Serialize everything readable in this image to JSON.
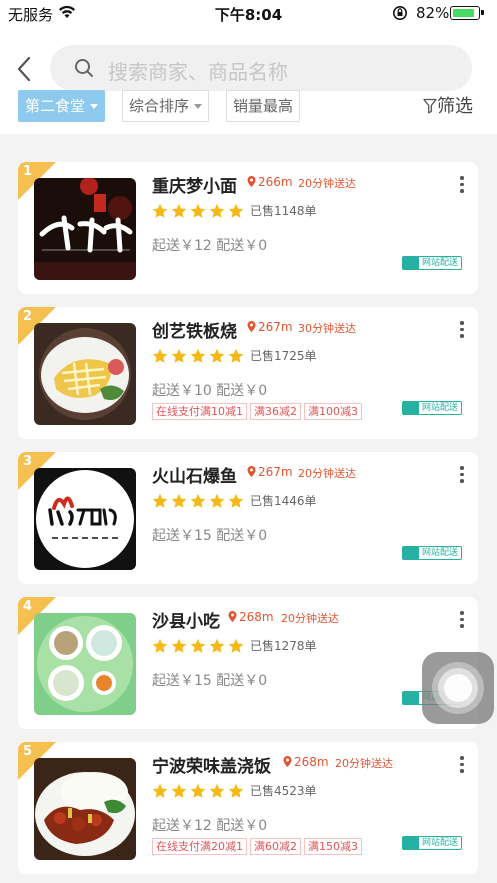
{
  "status_bar": {
    "carrier": "无服务",
    "time": "下午8:04",
    "battery": "82%"
  },
  "search": {
    "placeholder": "搜索商家、商品名称"
  },
  "filters": {
    "canteen": "第二食堂",
    "sort": "综合排序",
    "sales": "销量最高",
    "filter": "筛选"
  },
  "delivery_tag": "网站配送",
  "colors": {
    "accent": "#8ec9ee",
    "rank": "#f5c04f",
    "star": "#f5b917",
    "distance": "#e2552f",
    "delivery": "#27b1a3"
  },
  "stores": [
    {
      "rank": "1",
      "name": "重庆梦小面",
      "distance": "266m",
      "eta": "20分钟送达",
      "rating": 5,
      "sold": "已售1148单",
      "min_order": "起送￥12",
      "delivery_fee": "配送￥0",
      "promos": [],
      "thumb_icon": "noodle-poster-image"
    },
    {
      "rank": "2",
      "name": "创艺铁板烧",
      "distance": "267m",
      "eta": "30分钟送达",
      "rating": 5,
      "sold": "已售1725单",
      "min_order": "起送￥10",
      "delivery_fee": "配送￥0",
      "promos": [
        "在线支付满10减1",
        "满36减2",
        "满100减3"
      ],
      "thumb_icon": "teppanyaki-plate-image"
    },
    {
      "rank": "3",
      "name": "火山石爆鱼",
      "distance": "267m",
      "eta": "20分钟送达",
      "rating": 5,
      "sold": "已售1446单",
      "min_order": "起送￥15",
      "delivery_fee": "配送￥0",
      "promos": [],
      "thumb_icon": "volcano-fish-logo"
    },
    {
      "rank": "4",
      "name": "沙县小吃",
      "distance": "268m",
      "eta": "20分钟送达",
      "rating": 5,
      "sold": "已售1278单",
      "min_order": "起送￥15",
      "delivery_fee": "配送￥0",
      "promos": [],
      "thumb_icon": "snack-bowls-image"
    },
    {
      "rank": "5",
      "name": "宁波荣味盖浇饭",
      "distance": "268m",
      "eta": "20分钟送达",
      "rating": 5,
      "sold": "已售4523单",
      "min_order": "起送￥12",
      "delivery_fee": "配送￥0",
      "promos": [
        "在线支付满20减1",
        "满60减2",
        "满150减3"
      ],
      "thumb_icon": "rice-dish-image"
    }
  ]
}
